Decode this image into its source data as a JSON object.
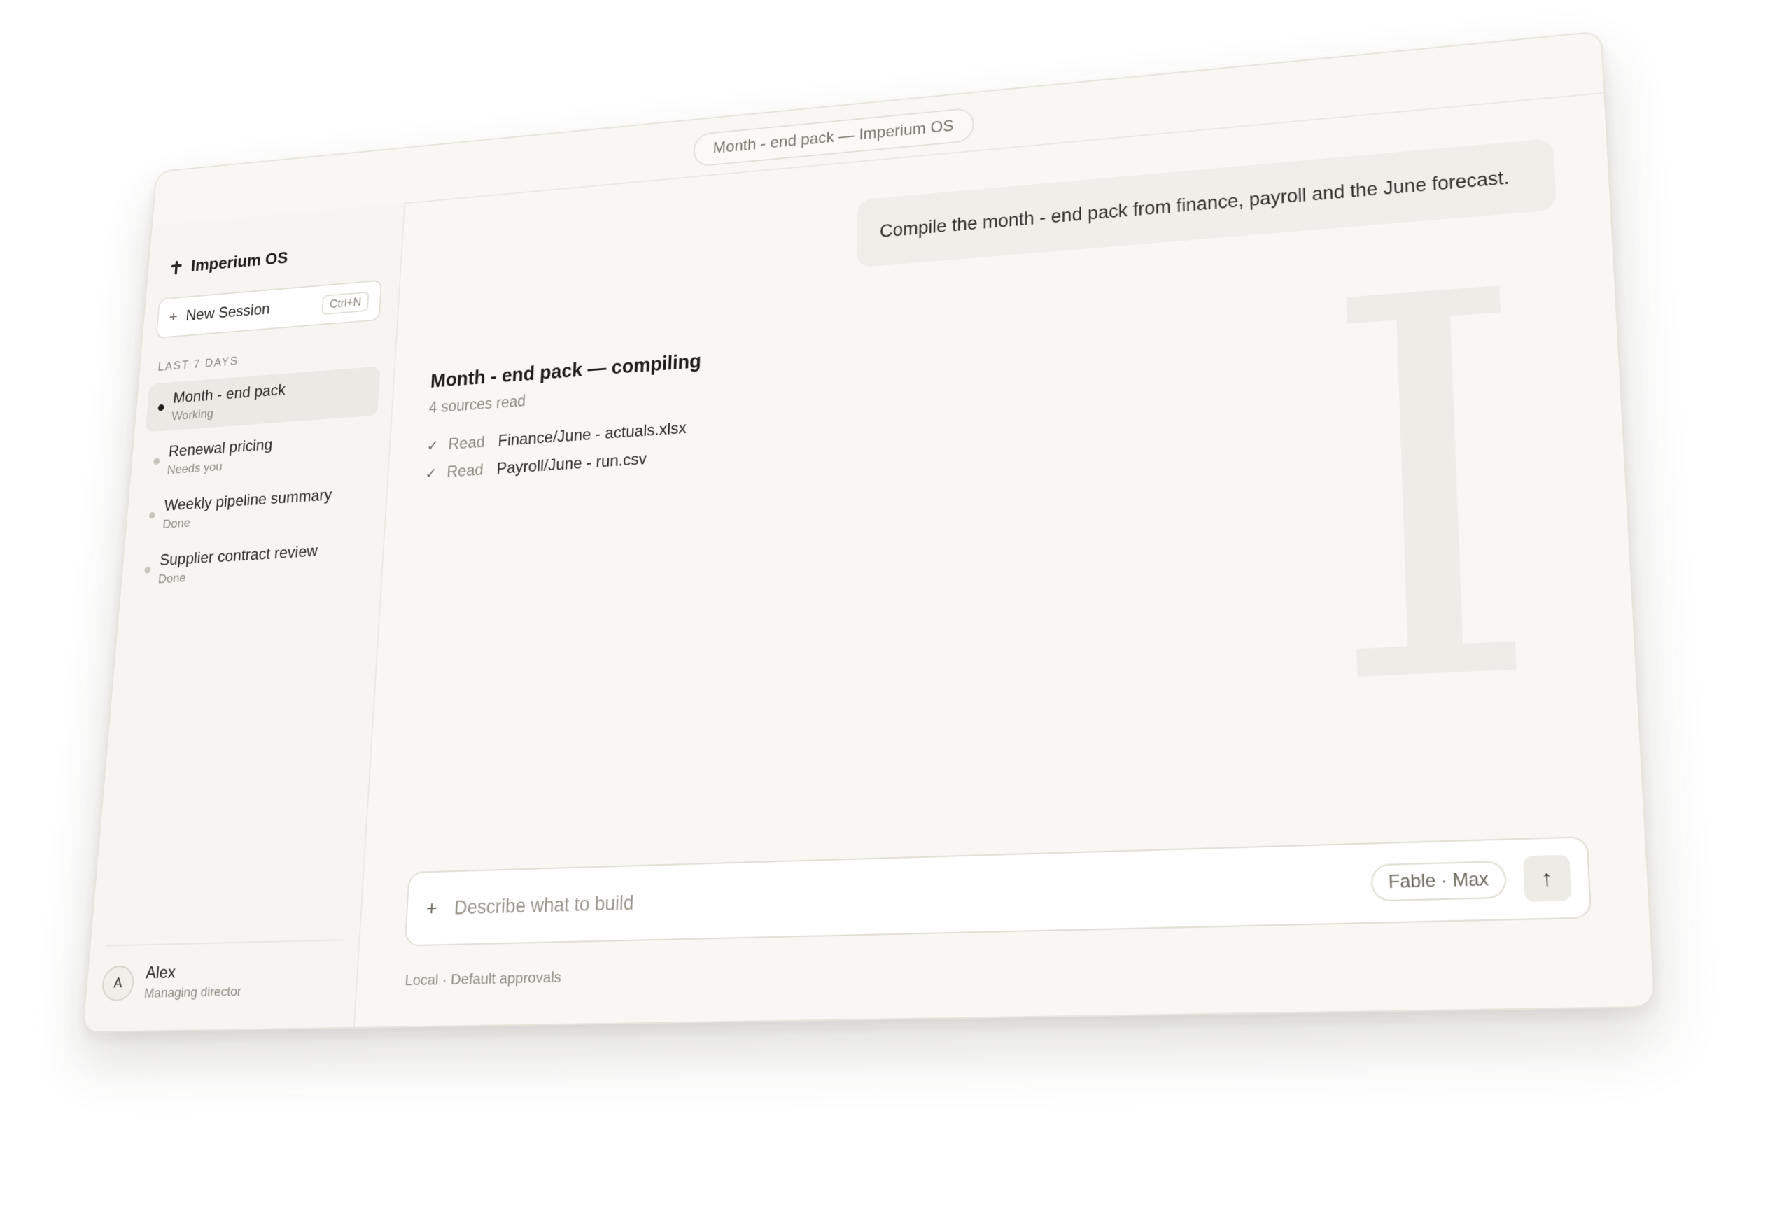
{
  "window": {
    "title": "Month - end pack — Imperium OS"
  },
  "sidebar": {
    "brand": "Imperium OS",
    "new_session": {
      "label": "New Session",
      "shortcut": "Ctrl+N"
    },
    "section_label": "LAST 7 DAYS",
    "sessions": [
      {
        "title": "Month - end pack",
        "status": "Working",
        "active": true
      },
      {
        "title": "Renewal pricing",
        "status": "Needs you",
        "active": false
      },
      {
        "title": "Weekly pipeline summary",
        "status": "Done",
        "active": false
      },
      {
        "title": "Supplier contract review",
        "status": "Done",
        "active": false
      }
    ],
    "user": {
      "initial": "A",
      "name": "Alex",
      "role": "Managing director"
    }
  },
  "main": {
    "user_message": "Compile the month - end pack from finance, payroll and the June forecast.",
    "watermark": "I",
    "task": {
      "title": "Month - end pack — compiling",
      "subtitle": "4 sources read",
      "steps": [
        {
          "verb": "Read",
          "file": "Finance/June - actuals.xlsx"
        },
        {
          "verb": "Read",
          "file": "Payroll/June - run.csv"
        }
      ]
    },
    "composer": {
      "placeholder": "Describe what to build",
      "model": "Fable · Max"
    },
    "footnote": "Local · Default approvals"
  },
  "icons": {
    "brand": "imperium-logo-icon",
    "new_session": "plus-icon",
    "step": "check-icon",
    "composer_add": "plus-icon",
    "send": "arrow-up-icon"
  },
  "colors": {
    "background": "#f8f7f3",
    "active_session": "#ebe9e3",
    "user_bubble": "#efeee9",
    "active_dot": "#1d1c19"
  }
}
